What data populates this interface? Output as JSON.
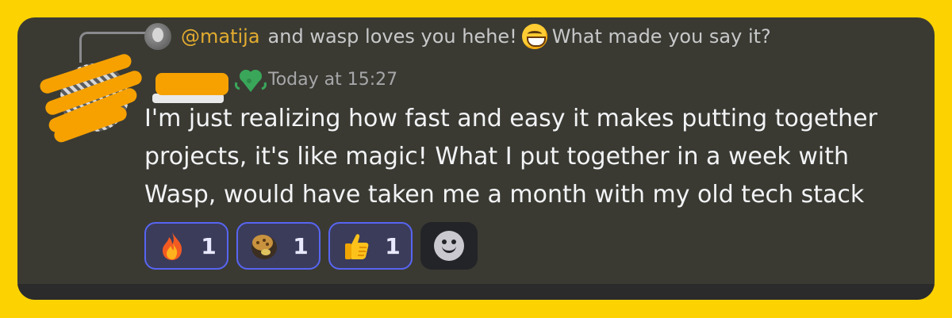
{
  "reply": {
    "mention": "@matija",
    "text_before_emoji": "and wasp loves you hehe!",
    "emoji": "grinning-face-icon",
    "text_after_emoji": "What made you say it?"
  },
  "message": {
    "timestamp": "Today at 15:27",
    "lines": [
      "I'm just realizing how fast and easy it makes putting together",
      "projects, it's like magic! What I put together in a week with",
      "Wasp, would have taken me a month with my old tech stack"
    ]
  },
  "reactions": [
    {
      "icon": "fire-icon",
      "count": "1"
    },
    {
      "icon": "cookie-icon",
      "count": "1"
    },
    {
      "icon": "thumbs-up-icon",
      "count": "1"
    }
  ],
  "colors": {
    "background": "#fcd200",
    "card": "#3a3a33",
    "mention": "#e3ac2f",
    "reaction_border": "#5865f2",
    "redaction": "#f6a100"
  }
}
